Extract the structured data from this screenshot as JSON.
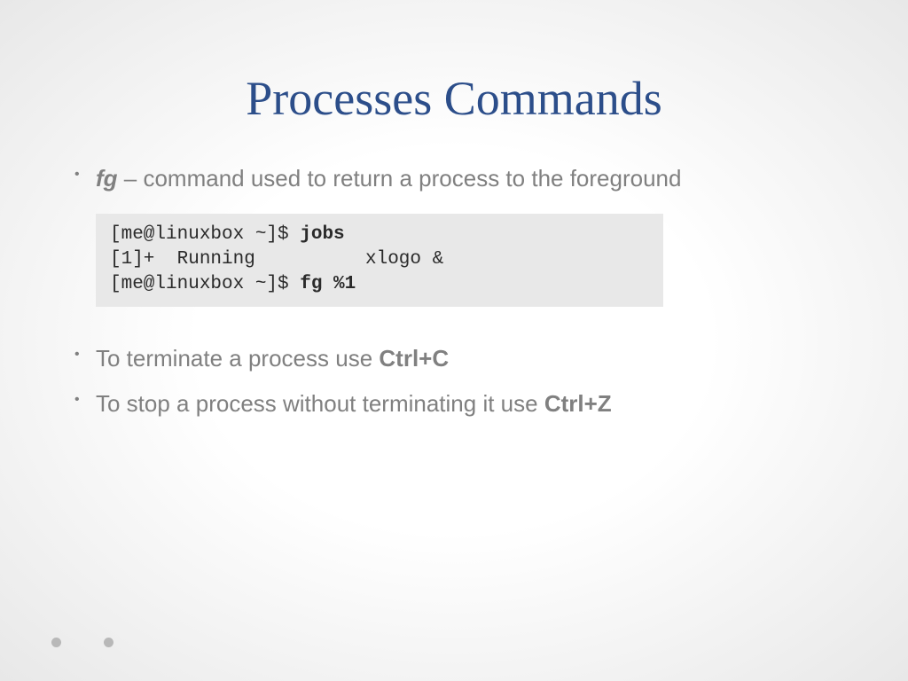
{
  "title": "Processes Commands",
  "bullets": {
    "b1_bold": "fg",
    "b1_rest": " – command used to return a process to the foreground",
    "b2_pre": "To terminate a process use ",
    "b2_bold": "Ctrl+C",
    "b3_pre": "To stop a process without terminating it use ",
    "b3_bold": "Ctrl+Z"
  },
  "code": {
    "prompt1": "[me@linuxbox ~]$ ",
    "cmd1": "jobs",
    "line2_left": "[1]+  Running",
    "line2_right": "xlogo &",
    "prompt3": "[me@linuxbox ~]$ ",
    "cmd3": "fg %1"
  }
}
